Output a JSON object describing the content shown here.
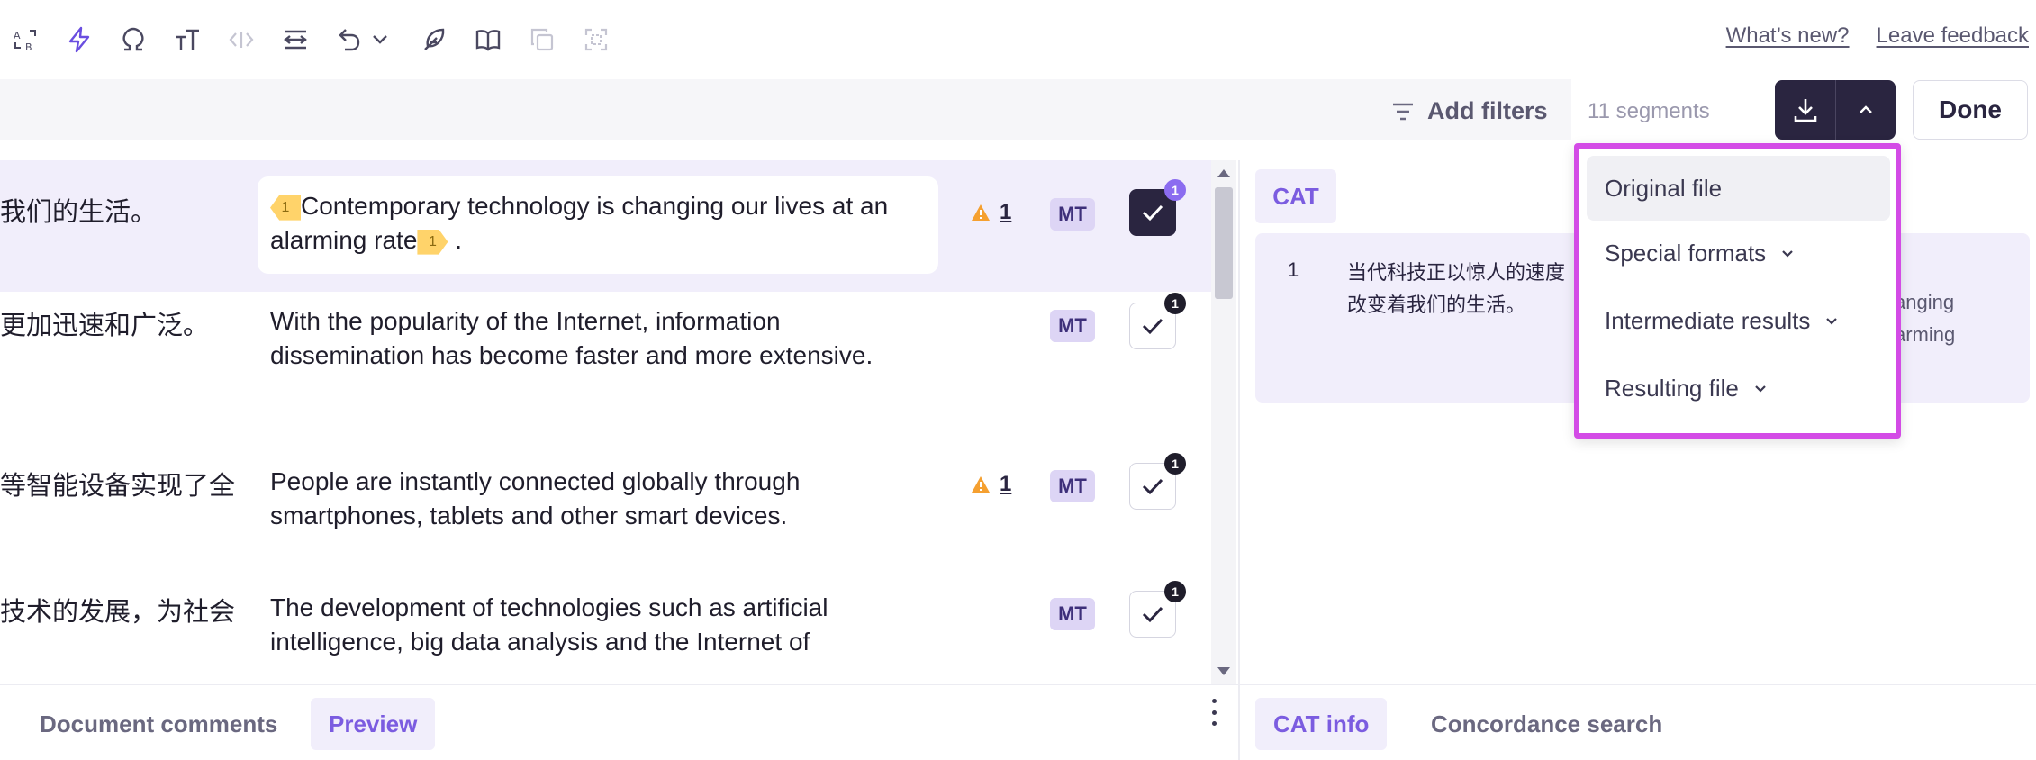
{
  "header": {
    "whats_new": "What’s new?",
    "leave_feedback": "Leave feedback"
  },
  "toolbar_icons": [
    "ab-case-icon",
    "lightning-icon",
    "omega-icon",
    "text-size-icon",
    "code-brackets-icon",
    "wrap-text-icon",
    "undo-icon",
    "chevron-down-icon",
    "feather-icon",
    "book-icon",
    "copy-icon",
    "expand-icon"
  ],
  "filters": {
    "add_filters": "Add filters",
    "segments_count": "11 segments",
    "done": "Done"
  },
  "segments": [
    {
      "source": "我们的生活。",
      "target_pre": "Contemporary technology is changing our lives at an alarming rate",
      "target_post": ".",
      "tag_label": "1",
      "warning_count": "1",
      "mt_label": "MT",
      "badge": "1",
      "confirmed": true
    },
    {
      "source": "更加迅速和广泛。",
      "target": "With the popularity of the Internet, information dissemination has become faster and more extensive.",
      "mt_label": "MT",
      "badge": "1"
    },
    {
      "source": "等智能设备实现了全",
      "target": "People are instantly connected globally through smartphones, tablets and other smart devices.",
      "warning_count": "1",
      "mt_label": "MT",
      "badge": "1"
    },
    {
      "source": "技术的发展，为社会",
      "target": "The development of technologies such as artificial intelligence, big data analysis and the Internet of",
      "mt_label": "MT",
      "badge": "1"
    }
  ],
  "bottom_left_tabs": {
    "comments": "Document comments",
    "preview": "Preview"
  },
  "bottom_right_tabs": {
    "cat_info": "CAT info",
    "concordance": "Concordance search"
  },
  "cat_panel": {
    "tab": "CAT",
    "number": "1",
    "source": "当代科技正以惊人的速度改变着我们的生活。",
    "target_fragment_1": "anging",
    "target_fragment_2": "arming"
  },
  "download_menu": {
    "items": [
      "Original file",
      "Special formats",
      "Intermediate results",
      "Resulting file"
    ]
  },
  "colors": {
    "accent": "#7b5ce0",
    "dark": "#2a2540",
    "highlight_border": "#d34be6",
    "tag": "#ffd36a",
    "warning": "#f5a030"
  }
}
